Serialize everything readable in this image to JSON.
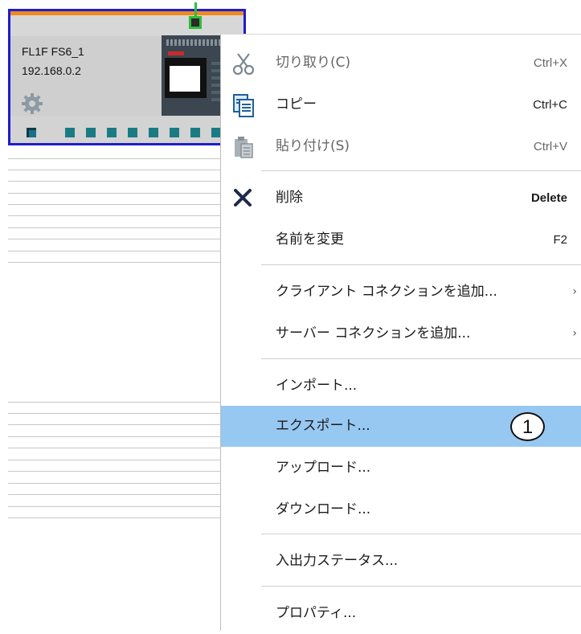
{
  "device": {
    "name": "FL1F FS6_1",
    "ip": "192.168.0.2"
  },
  "menu": {
    "items": [
      {
        "label": "切り取り(C)",
        "shortcut": "Ctrl+X",
        "icon": "scissors-icon",
        "disabled": true
      },
      {
        "label": "コピー",
        "shortcut": "Ctrl+C",
        "icon": "copy-icon",
        "disabled": false
      },
      {
        "label": "貼り付け(S)",
        "shortcut": "Ctrl+V",
        "icon": "paste-icon",
        "disabled": true
      },
      {
        "label": "削除",
        "shortcut": "Delete",
        "icon": "delete-x-icon",
        "disabled": false
      },
      {
        "label": "名前を変更",
        "shortcut": "F2",
        "disabled": false
      },
      {
        "label": "クライアント コネクションを追加...",
        "submenu": true
      },
      {
        "label": "サーバー コネクションを追加...",
        "submenu": true
      },
      {
        "label": "インポート..."
      },
      {
        "label": "エクスポート...",
        "highlighted": true
      },
      {
        "label": "アップロード..."
      },
      {
        "label": "ダウンロード..."
      },
      {
        "label": "入出力ステータス..."
      },
      {
        "label": "プロパティ..."
      }
    ],
    "callout": "1",
    "highlight_color": "#97c8f2"
  },
  "colors": {
    "device_border": "#1d1dcc",
    "device_top_bar": "#f08a1c",
    "port_selected": "#2fbd3a",
    "port_teal": "#1b7b84"
  }
}
